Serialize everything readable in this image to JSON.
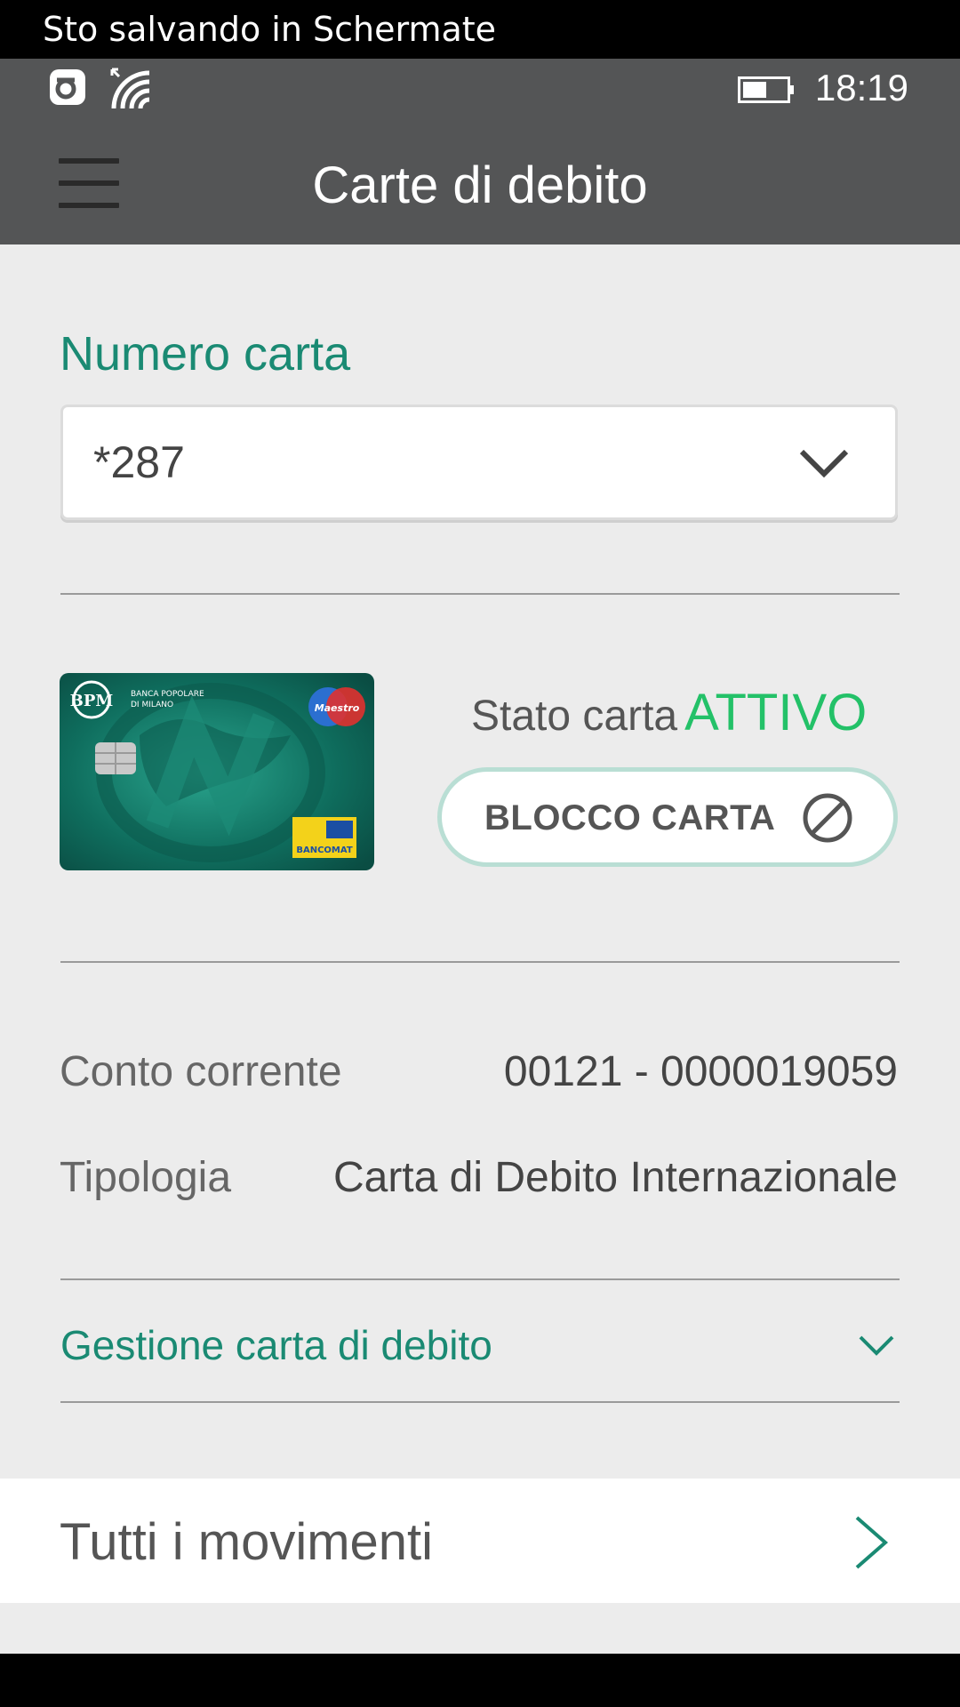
{
  "toast": {
    "text": "Sto salvando in Schermate"
  },
  "status_bar": {
    "time": "18:19",
    "icons": [
      "nfc-icon",
      "wifi-icon",
      "battery-icon"
    ]
  },
  "app_bar": {
    "title": "Carte di debito",
    "menu_icon": "hamburger-icon"
  },
  "card_selector": {
    "label": "Numero carta",
    "selected_value": "*287"
  },
  "card": {
    "image_brand": [
      "BPM",
      "BANCA POPOLARE DI MILANO",
      "Maestro",
      "BANCOMAT"
    ],
    "status_label": "Stato carta",
    "status_value": "ATTIVO",
    "block_button_label": "BLOCCO CARTA"
  },
  "details": {
    "account_label": "Conto corrente",
    "account_value": "00121 - 0000019059",
    "type_label": "Tipologia",
    "type_value": "Carta di Debito Internazionale"
  },
  "management": {
    "label": "Gestione carta di debito"
  },
  "movements": {
    "label": "Tutti i movimenti"
  },
  "colors": {
    "accent_green": "#1a8a73",
    "status_green": "#23c168",
    "header_gray": "#545556",
    "background": "#ececec"
  }
}
